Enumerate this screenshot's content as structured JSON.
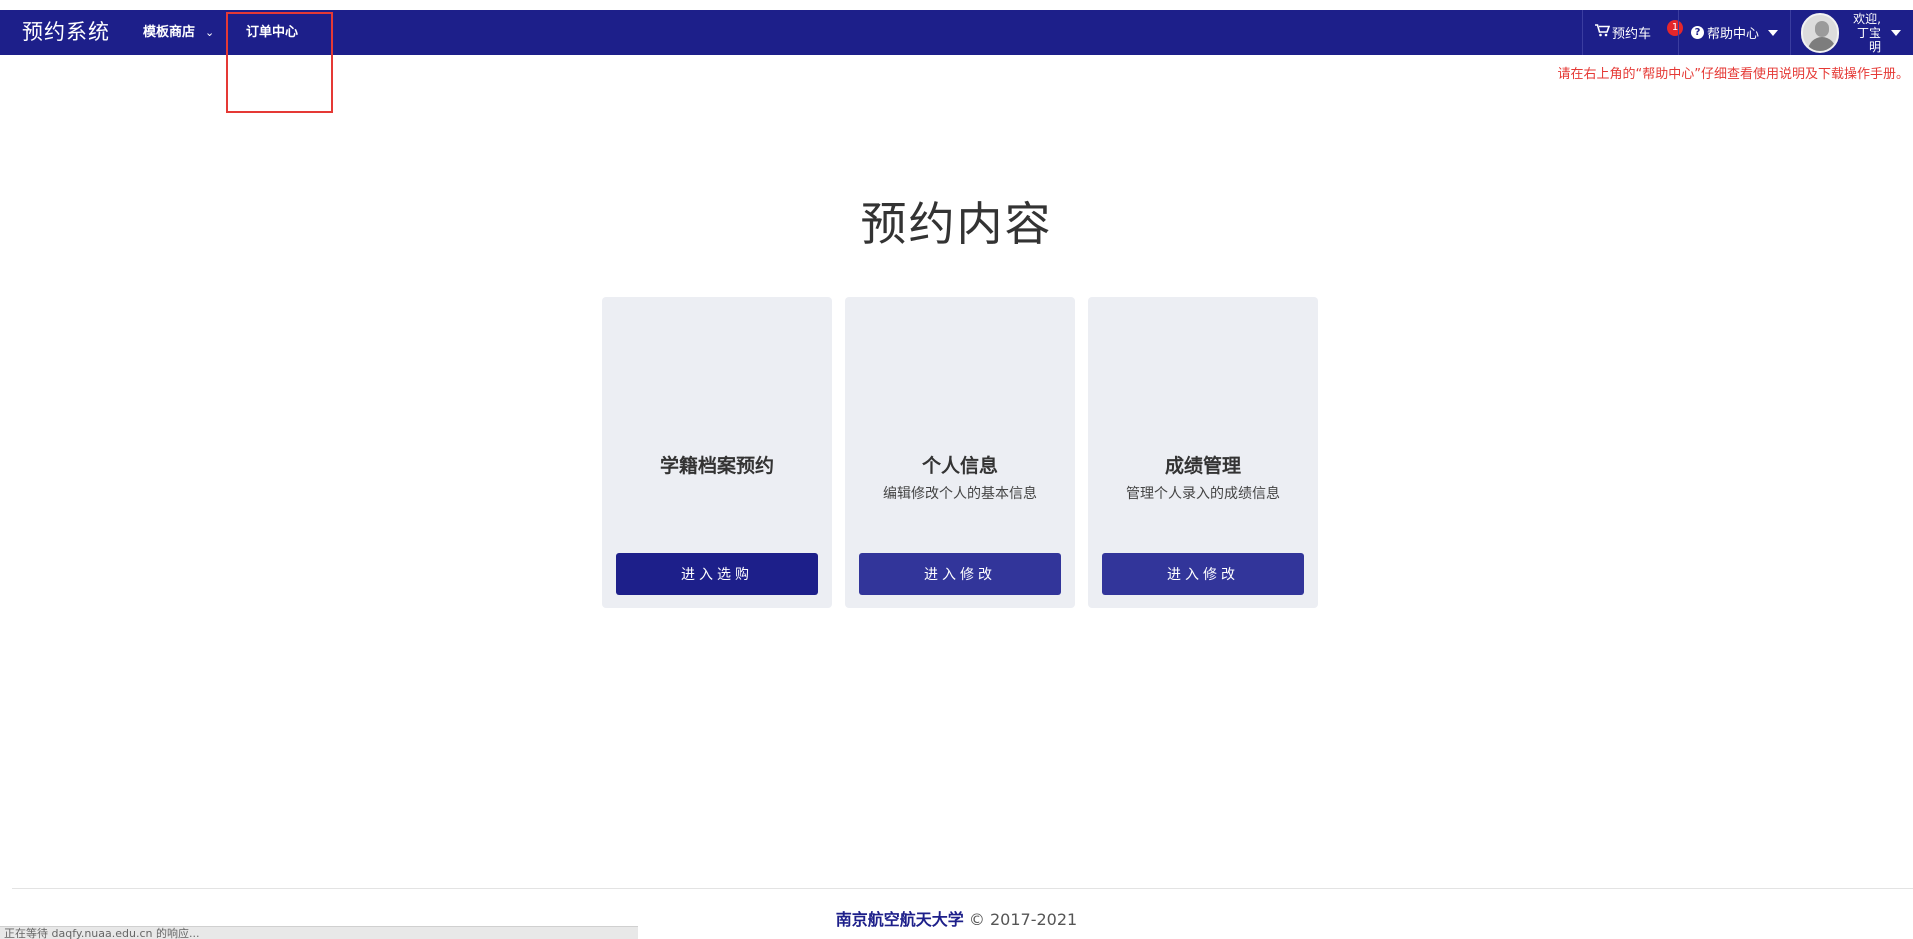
{
  "navbar": {
    "brand": "预约系统",
    "menu": [
      {
        "label": "模板商店"
      },
      {
        "label": "订单中心"
      }
    ],
    "cart": {
      "label": "预约车",
      "badge": "1"
    },
    "help": {
      "label": "帮助中心"
    },
    "user": {
      "welcome": "欢迎,",
      "name": "丁宝明"
    }
  },
  "notice": "请在右上角的“帮助中心”仔细查看使用说明及下载操作手册。",
  "main": {
    "title": "预约内容",
    "cards": [
      {
        "title": "学籍档案预约",
        "desc": "",
        "button": "进入选购"
      },
      {
        "title": "个人信息",
        "desc": "编辑修改个人的基本信息",
        "button": "进入修改"
      },
      {
        "title": "成绩管理",
        "desc": "管理个人录入的成绩信息",
        "button": "进入修改"
      }
    ]
  },
  "footer": {
    "university": "南京航空航天大学",
    "copyright": "© 2017-2021"
  },
  "statusbar": "正在等待 daqfy.nuaa.edu.cn 的响应...",
  "colors": {
    "navbar": "#1d1f8a",
    "button_dark": "#1d1f8a",
    "button_mid": "#32359a",
    "badge": "#e5262b",
    "notice": "#e53935"
  }
}
